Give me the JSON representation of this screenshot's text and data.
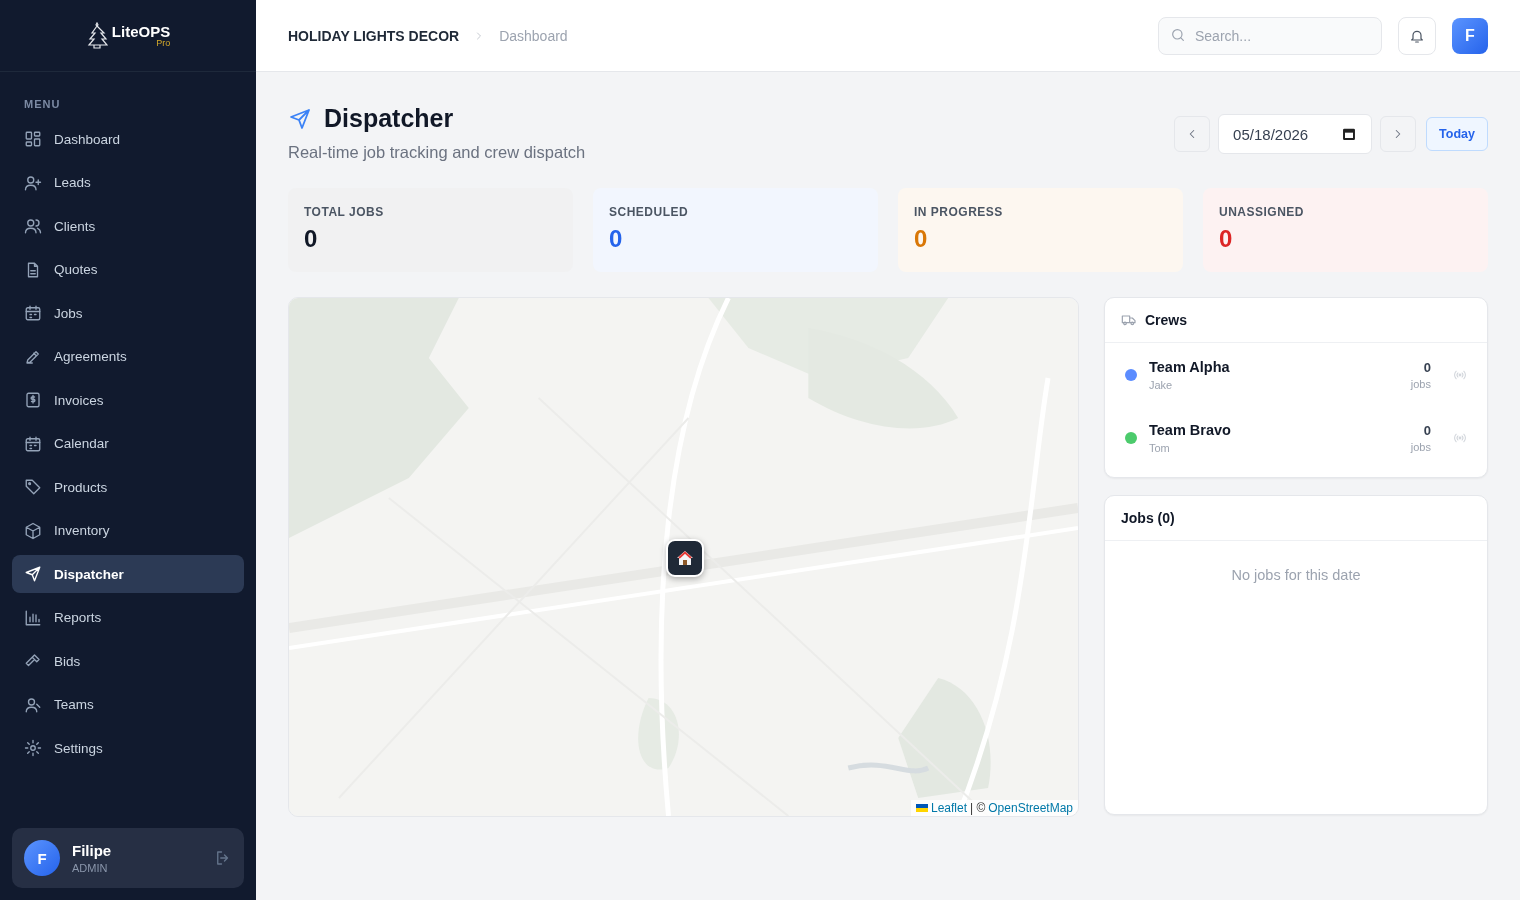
{
  "brand": {
    "name": "LiteOPS",
    "suffix": "Pro"
  },
  "sidebar": {
    "heading": "MENU",
    "items": [
      {
        "label": "Dashboard",
        "selected": false
      },
      {
        "label": "Leads",
        "selected": false
      },
      {
        "label": "Clients",
        "selected": false
      },
      {
        "label": "Quotes",
        "selected": false
      },
      {
        "label": "Jobs",
        "selected": false
      },
      {
        "label": "Agreements",
        "selected": false
      },
      {
        "label": "Invoices",
        "selected": false
      },
      {
        "label": "Calendar",
        "selected": false
      },
      {
        "label": "Products",
        "selected": false
      },
      {
        "label": "Inventory",
        "selected": false
      },
      {
        "label": "Dispatcher",
        "selected": true
      },
      {
        "label": "Reports",
        "selected": false
      },
      {
        "label": "Bids",
        "selected": false
      },
      {
        "label": "Teams",
        "selected": false
      },
      {
        "label": "Settings",
        "selected": false
      }
    ],
    "user": {
      "initial": "F",
      "name": "Filipe",
      "role": "ADMIN"
    }
  },
  "topbar": {
    "breadcrumbs": [
      "HOLIDAY LIGHTS DECOR",
      "Dashboard"
    ],
    "search": {
      "placeholder": "Search..."
    },
    "avatar": "F"
  },
  "page": {
    "title": "Dispatcher",
    "subtitle": "Real-time job tracking and crew dispatch",
    "date": "05/18/2026",
    "today_button": "Today"
  },
  "stats": [
    {
      "label": "TOTAL JOBS",
      "value": "0",
      "color": "#111827"
    },
    {
      "label": "SCHEDULED",
      "value": "0",
      "color": "#2563eb"
    },
    {
      "label": "IN PROGRESS",
      "value": "0",
      "color": "#d97706"
    },
    {
      "label": "UNASSIGNED",
      "value": "0",
      "color": "#dc2626"
    }
  ],
  "map": {
    "kind": "picture",
    "attribution": {
      "leaflet": "Leaflet",
      "separator": "| ©",
      "osm": "OpenStreetMap"
    }
  },
  "crews": {
    "title": "Crews",
    "items": [
      {
        "name": "Team Alpha",
        "lead": "Jake",
        "count": "0",
        "unit": "jobs",
        "color": "#5b8cff"
      },
      {
        "name": "Team Bravo",
        "lead": "Tom",
        "count": "0",
        "unit": "jobs",
        "color": "#4ccb6c"
      }
    ]
  },
  "jobs": {
    "title": "Jobs (0)",
    "empty": "No jobs for this date"
  }
}
